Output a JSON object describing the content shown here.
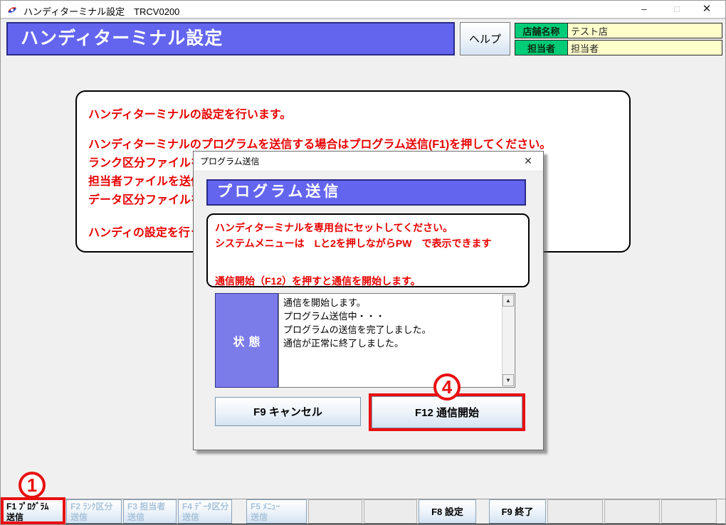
{
  "window": {
    "title": "ハンディターミナル設定　TRCV0200",
    "controls": {
      "minimize": "–",
      "maximize": "□",
      "close": "✕"
    }
  },
  "header": {
    "banner": "ハンディターミナル設定",
    "help_label": "ヘルプ",
    "store_label": "店舗名称",
    "store_value": "テスト店",
    "staff_label": "担当者",
    "staff_value": "担当者"
  },
  "main_message": {
    "lines": [
      "ハンディターミナルの設定を行います。",
      "ハンディターミナルのプログラムを送信する場合はプログラム送信(F1)を押してください。",
      "ランク区分ファイルを送",
      "担当者ファイルを送信",
      "データ区分ファイルを送",
      "ハンディの設定を行う場"
    ]
  },
  "dialog": {
    "titlebar": "プログラム送信",
    "close": "✕",
    "banner": "プログラム送信",
    "instructions": [
      "ハンディターミナルを専用台にセットしてください。",
      "システムメニューは　Lと2を押しながらPW　で表示できます",
      "通信開始（F12）を押すと通信を開始します。"
    ],
    "status_label": "状態",
    "status_lines": [
      "通信を開始します。",
      "プログラム送信中・・・",
      "プログラムの送信を完了しました。",
      "通信が正常に終了しました。"
    ],
    "scroll_up": "▲",
    "scroll_down": "▼",
    "cancel_button": "F9 キャンセル",
    "start_button": "F12 通信開始",
    "annotation": "4"
  },
  "function_bar": {
    "annotation": "1",
    "keys": [
      {
        "line1": "F1 ﾌﾟﾛｸﾞﾗﾑ",
        "line2": "送信"
      },
      {
        "line1": "F2 ﾗﾝｸ区分",
        "line2": "送信"
      },
      {
        "line1": "F3 担当者",
        "line2": "送信"
      },
      {
        "line1": "F4 ﾃﾞｰﾀ区分",
        "line2": "送信"
      },
      {
        "line1": "F5 ﾒﾆｭｰ",
        "line2": "送信"
      },
      {
        "label": "F8 設定"
      },
      {
        "label": "F9 終了"
      }
    ]
  },
  "colors": {
    "banner_blue": "#6365ef",
    "status_blue": "#7b7bea",
    "label_green": "#00cc77",
    "field_yellow": "#ffffcc",
    "message_red": "#e80000",
    "annotation_red": "#e81010"
  }
}
